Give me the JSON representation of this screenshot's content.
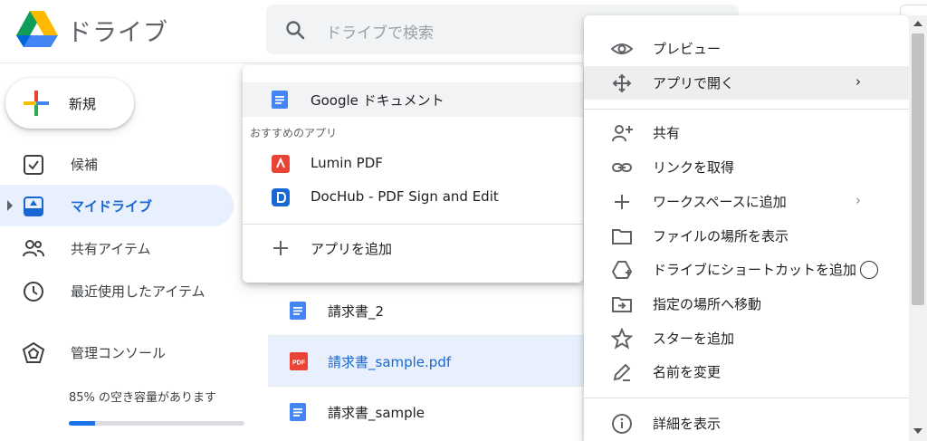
{
  "header": {
    "app_title": "ドライブ",
    "search_placeholder": "ドライブで検索"
  },
  "sidebar": {
    "new_label": "新規",
    "items": [
      {
        "label": "候補",
        "icon": "check-square-icon"
      },
      {
        "label": "マイドライブ",
        "icon": "my-drive-icon",
        "active": true
      },
      {
        "label": "共有アイテム",
        "icon": "people-icon"
      },
      {
        "label": "最近使用したアイテム",
        "icon": "clock-icon"
      },
      {
        "label": "管理コンソール",
        "icon": "admin-console-icon"
      }
    ],
    "storage_text": "85% の空き容量があります",
    "storage_used_fraction": 0.15
  },
  "files": [
    {
      "name": "請求書_2",
      "type": "doc"
    },
    {
      "name": "請求書_sample.pdf",
      "type": "pdf",
      "selected": true
    },
    {
      "name": "請求書_sample",
      "type": "doc"
    }
  ],
  "open_with_menu": {
    "top_item": "Google ドキュメント",
    "section_label": "おすすめのアプリ",
    "apps": [
      "Lumin PDF",
      "DocHub - PDF Sign and Edit"
    ],
    "add_app": "アプリを追加"
  },
  "context_menu": {
    "items": [
      {
        "label": "プレビュー",
        "icon": "eye-icon"
      },
      {
        "label": "アプリで開く",
        "icon": "move-arrows-icon",
        "submenu": true,
        "highlighted": true
      },
      {
        "label": "共有",
        "icon": "person-add-icon"
      },
      {
        "label": "リンクを取得",
        "icon": "link-icon"
      },
      {
        "label": "ワークスペースに追加",
        "icon": "plus-icon",
        "submenu": true
      },
      {
        "label": "ファイルの場所を表示",
        "icon": "folder-icon"
      },
      {
        "label": "ドライブにショートカットを追加",
        "icon": "drive-shortcut-icon"
      },
      {
        "label": "指定の場所へ移動",
        "icon": "move-to-folder-icon"
      },
      {
        "label": "スターを追加",
        "icon": "star-icon"
      },
      {
        "label": "名前を変更",
        "icon": "pencil-icon"
      },
      {
        "label": "詳細を表示",
        "icon": "info-icon"
      }
    ]
  },
  "colors": {
    "accent": "#1a73e8",
    "active_bg": "#e8f0fe",
    "doc_blue": "#4285f4",
    "pdf_red": "#ea4335"
  }
}
